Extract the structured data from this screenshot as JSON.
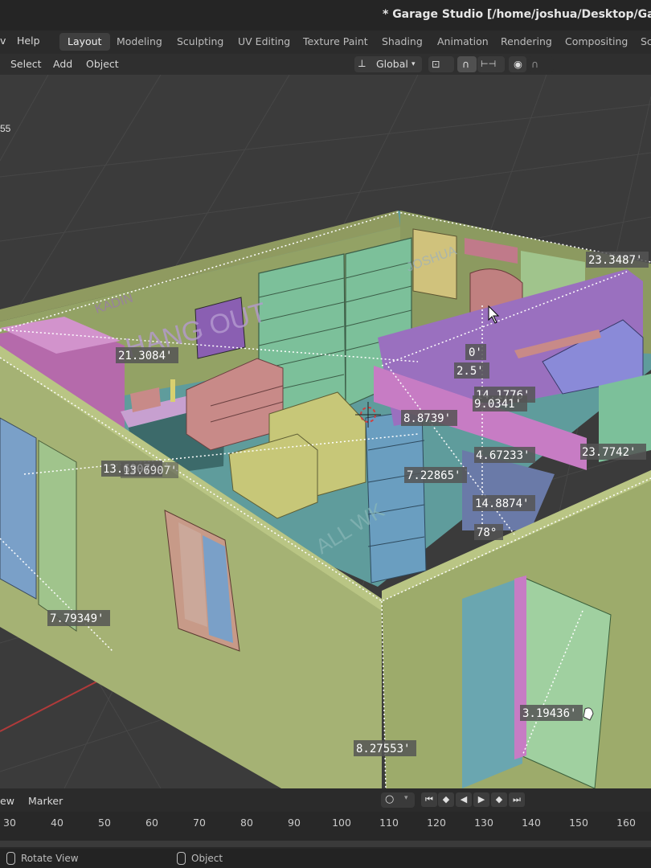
{
  "window": {
    "title": "* Garage Studio [/home/joshua/Desktop/Garage"
  },
  "menubar": {
    "help": "Help",
    "left_partial": "v",
    "tabs": [
      {
        "label": "Layout",
        "active": true
      },
      {
        "label": "Modeling"
      },
      {
        "label": "Sculpting"
      },
      {
        "label": "UV Editing"
      },
      {
        "label": "Texture Paint"
      },
      {
        "label": "Shading"
      },
      {
        "label": "Animation"
      },
      {
        "label": "Rendering"
      },
      {
        "label": "Compositing"
      },
      {
        "label": "Sc"
      }
    ]
  },
  "header": {
    "select": "Select",
    "add": "Add",
    "object": "Object",
    "orientation": "Global"
  },
  "viewport": {
    "corner_text": "55",
    "scene_texts": {
      "hang_out": "HANG OUT",
      "kadin": "KADIN",
      "joshua": "JOSHUA",
      "all_wk": "ALL WK"
    },
    "dimensions": [
      "23.3487'",
      "21.3084'",
      "0'",
      "2.5'",
      "14.1776'",
      "9.0341'",
      "8.8739'",
      "13.6907'",
      "13.6907'",
      "4.67233'",
      "23.7742'",
      "7.22865'",
      "14.8874'",
      "78°",
      "7.79349'",
      "3.19436'",
      "8.27553'"
    ]
  },
  "timeline": {
    "view_partial": "ew",
    "marker": "Marker",
    "frames": [
      "30",
      "40",
      "50",
      "60",
      "70",
      "80",
      "90",
      "100",
      "110",
      "120",
      "130",
      "140",
      "150",
      "160"
    ]
  },
  "statusbar": {
    "rotate": "Rotate View",
    "object": "Object"
  },
  "colors": {
    "floor": "#5f9c9c",
    "wall": "#a5b274",
    "pink": "#c67cc0",
    "grid_bg": "#3b3b3b",
    "accent_tab": "#3f3f3f"
  }
}
